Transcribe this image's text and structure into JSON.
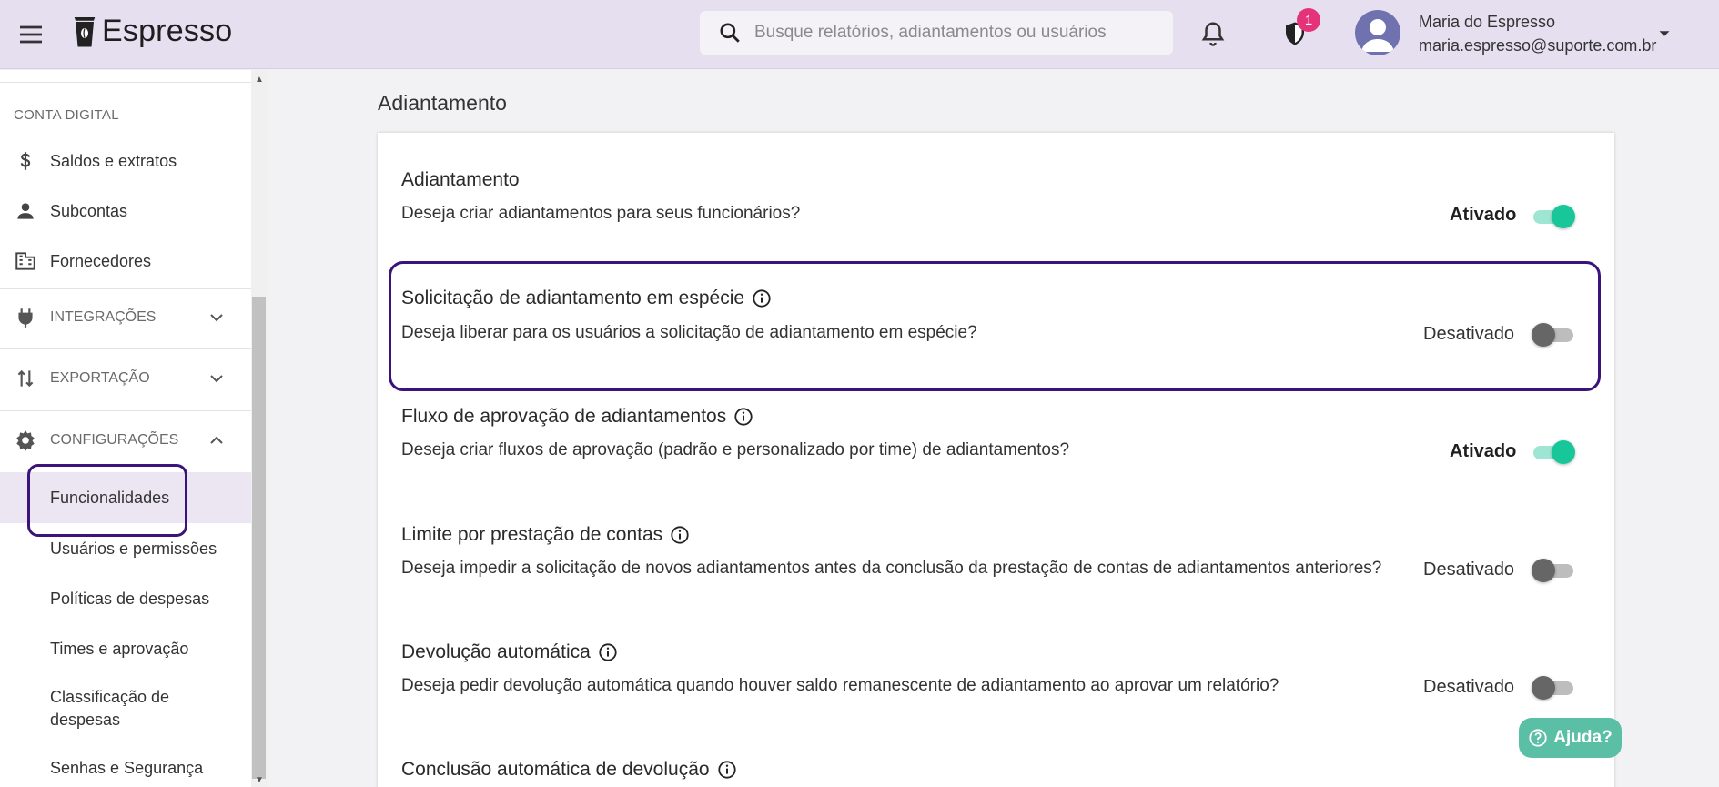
{
  "app": {
    "name": "Espresso"
  },
  "search": {
    "placeholder": "Busque relatórios, adiantamentos ou usuários"
  },
  "notifications": {
    "shield_count": "1"
  },
  "user": {
    "name": "Maria do Espresso",
    "email": "maria.espresso@suporte.com.br"
  },
  "sidebar": {
    "section_conta": "CONTA DIGITAL",
    "items": [
      {
        "label": "Saldos e extratos",
        "icon": "dollar-icon"
      },
      {
        "label": "Subcontas",
        "icon": "person-icon"
      },
      {
        "label": "Fornecedores",
        "icon": "building-icon"
      }
    ],
    "groups": [
      {
        "label": "INTEGRAÇÕES",
        "icon": "plug-icon",
        "expanded": false
      },
      {
        "label": "EXPORTAÇÃO",
        "icon": "swap-vertical-icon",
        "expanded": false
      },
      {
        "label": "CONFIGURAÇÕES",
        "icon": "gear-icon",
        "expanded": true
      }
    ],
    "sub_items": [
      {
        "label": "Funcionalidades",
        "active": true
      },
      {
        "label": "Usuários e permissões"
      },
      {
        "label": "Políticas de despesas"
      },
      {
        "label": "Times e aprovação"
      },
      {
        "label": "Classificação de despesas"
      },
      {
        "label": "Senhas e Segurança"
      }
    ]
  },
  "main": {
    "title": "Adiantamento",
    "rows": [
      {
        "title": "Adiantamento",
        "description": "Deseja criar adiantamentos para seus funcionários?",
        "status": "Ativado",
        "enabled": true,
        "info": false
      },
      {
        "title": "Solicitação de adiantamento em espécie",
        "description": "Deseja liberar para os usuários a solicitação de adiantamento em espécie?",
        "status": "Desativado",
        "enabled": false,
        "info": true
      },
      {
        "title": "Fluxo de aprovação de adiantamentos",
        "description": "Deseja criar fluxos de aprovação (padrão e personalizado por time) de adiantamentos?",
        "status": "Ativado",
        "enabled": true,
        "info": true
      },
      {
        "title": "Limite por prestação de contas",
        "description": "Deseja impedir a solicitação de novos adiantamentos antes da conclusão da prestação de contas de adiantamentos anteriores?",
        "status": "Desativado",
        "enabled": false,
        "info": true
      },
      {
        "title": "Devolução automática",
        "description": "Deseja pedir devolução automática quando houver saldo remanescente de adiantamento ao aprovar um relatório?",
        "status": "Desativado",
        "enabled": false,
        "info": true
      },
      {
        "title": "Conclusão automática de devolução",
        "info": true
      }
    ]
  },
  "help": {
    "label": "Ajuda?"
  },
  "colors": {
    "accent": "#17c79a",
    "highlight": "#3b137a",
    "topbar": "#e6dff0",
    "badge": "#e5337a"
  }
}
